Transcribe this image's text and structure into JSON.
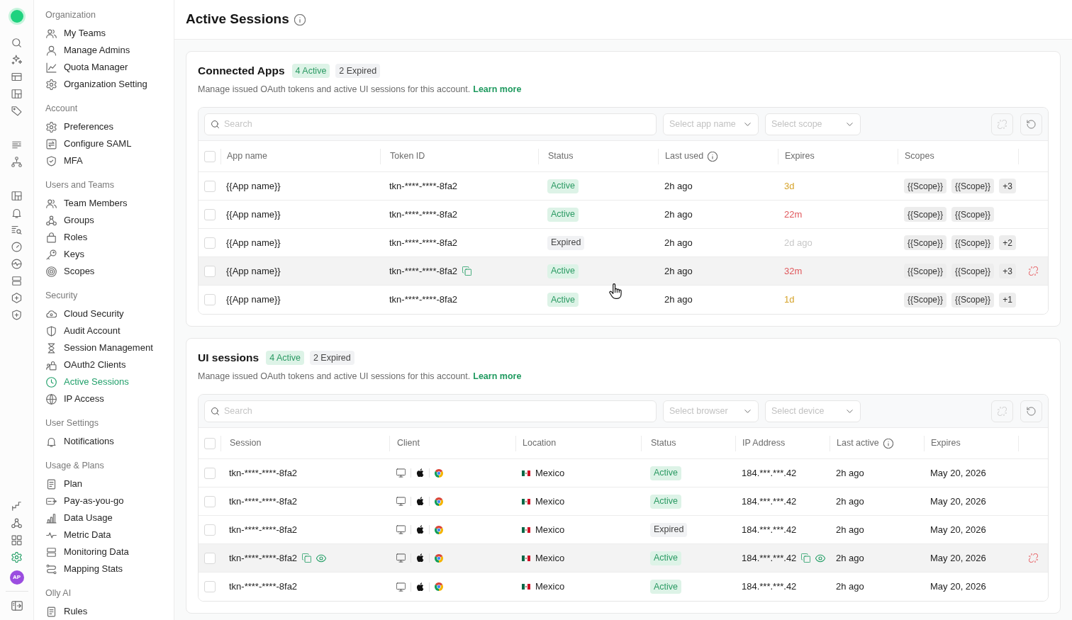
{
  "rail": {
    "items": [
      {
        "selected": false
      },
      {
        "selected": false
      },
      {
        "selected": false
      },
      {
        "selected": false
      },
      {
        "selected": false
      },
      {
        "selected": false
      },
      {
        "selected": false
      },
      {
        "selected": false
      },
      {
        "selected": false
      },
      {
        "selected": false
      },
      {
        "selected": false
      },
      {
        "selected": false
      },
      {
        "selected": false
      },
      {
        "selected": false
      },
      {
        "selected": false
      },
      {
        "selected": false
      },
      {
        "selected": false
      },
      {
        "selected": false
      },
      {
        "selected": true
      }
    ],
    "avatar": "AP"
  },
  "sidebar": {
    "sections": [
      {
        "title": "Organization",
        "items": [
          {
            "label": "My Teams",
            "selected": false
          },
          {
            "label": "Manage Admins",
            "selected": false
          },
          {
            "label": "Quota Manager",
            "selected": false
          },
          {
            "label": "Organization Setting",
            "selected": false
          }
        ]
      },
      {
        "title": "Account",
        "items": [
          {
            "label": "Preferences",
            "selected": false
          },
          {
            "label": "Configure SAML",
            "selected": false
          },
          {
            "label": "MFA",
            "selected": false
          }
        ]
      },
      {
        "title": "Users and Teams",
        "items": [
          {
            "label": "Team Members",
            "selected": false
          },
          {
            "label": "Groups",
            "selected": false
          },
          {
            "label": "Roles",
            "selected": false
          },
          {
            "label": "Keys",
            "selected": false
          },
          {
            "label": "Scopes",
            "selected": false
          }
        ]
      },
      {
        "title": "Security",
        "items": [
          {
            "label": "Cloud Security",
            "selected": false
          },
          {
            "label": "Audit Account",
            "selected": false
          },
          {
            "label": "Session Management",
            "selected": false
          },
          {
            "label": "OAuth2 Clients",
            "selected": false
          },
          {
            "label": "Active Sessions",
            "selected": true
          },
          {
            "label": "IP Access",
            "selected": false
          }
        ]
      },
      {
        "title": "User Settings",
        "items": [
          {
            "label": "Notifications",
            "selected": false
          }
        ]
      },
      {
        "title": "Usage & Plans",
        "items": [
          {
            "label": "Plan",
            "selected": false
          },
          {
            "label": "Pay-as-you-go",
            "selected": false
          },
          {
            "label": "Data Usage",
            "selected": false
          },
          {
            "label": "Metric Data",
            "selected": false
          },
          {
            "label": "Monitoring Data",
            "selected": false
          },
          {
            "label": "Mapping Stats",
            "selected": false
          }
        ]
      },
      {
        "title": "Olly AI",
        "items": [
          {
            "label": "Rules",
            "selected": false
          }
        ]
      }
    ]
  },
  "page": {
    "title": "Active Sessions"
  },
  "connected_apps": {
    "title": "Connected Apps",
    "badges": [
      {
        "text": "4 Active",
        "kind": "active"
      },
      {
        "text": "2 Expired",
        "kind": "expired"
      }
    ],
    "description": "Manage issued OAuth tokens and active UI sessions for this account.",
    "link": "Learn more",
    "toolbar": {
      "search": {
        "placeholder": "Search"
      },
      "filters": [
        {
          "placeholder": "Select app name"
        },
        {
          "placeholder": "Select scope"
        }
      ],
      "revoke": {
        "disabled": true
      }
    },
    "table": {
      "all_checked": false,
      "columns": [
        {
          "label": "App name",
          "info": false
        },
        {
          "label": "Token ID",
          "info": false
        },
        {
          "label": "Status",
          "info": false
        },
        {
          "label": "Last used",
          "info": true
        },
        {
          "label": "Expires",
          "info": false
        },
        {
          "label": "Scopes",
          "info": false
        }
      ],
      "rows": [
        {
          "checked": false,
          "hovered": false,
          "app_name": "{{App name}}",
          "token": "tkn-****-****-8fa2",
          "status": "Active",
          "expired": false,
          "last_used": "2h ago",
          "expires": {
            "text": "3d",
            "color": "#d6a32a"
          },
          "scopes": [
            "{{Scope}}",
            "{{Scope}}"
          ],
          "more": "+3"
        },
        {
          "checked": false,
          "hovered": false,
          "app_name": "{{App name}}",
          "token": "tkn-****-****-8fa2",
          "status": "Active",
          "expired": false,
          "last_used": "2h ago",
          "expires": {
            "text": "22m",
            "color": "#e0575b"
          },
          "scopes": [
            "{{Scope}}",
            "{{Scope}}"
          ]
        },
        {
          "checked": false,
          "hovered": false,
          "app_name": "{{App name}}",
          "token": "tkn-****-****-8fa2",
          "status": "Expired",
          "expired": true,
          "last_used": "2h ago",
          "expires": {
            "text": "2d ago",
            "color": "#c8c8c8"
          },
          "scopes": [
            "{{Scope}}",
            "{{Scope}}"
          ],
          "more": "+2"
        },
        {
          "checked": false,
          "hovered": true,
          "app_name": "{{App name}}",
          "token": "tkn-****-****-8fa2",
          "status": "Active",
          "expired": false,
          "last_used": "2h ago",
          "expires": {
            "text": "32m",
            "color": "#e0575b"
          },
          "scopes": [
            "{{Scope}}",
            "{{Scope}}"
          ],
          "more": "+3"
        },
        {
          "checked": false,
          "hovered": false,
          "app_name": "{{App name}}",
          "token": "tkn-****-****-8fa2",
          "status": "Active",
          "expired": false,
          "last_used": "2h ago",
          "expires": {
            "text": "1d",
            "color": "#d6a32a"
          },
          "scopes": [
            "{{Scope}}",
            "{{Scope}}"
          ],
          "more": "+1"
        }
      ]
    }
  },
  "ui_sessions": {
    "title": "UI sessions",
    "badges": [
      {
        "text": "4 Active",
        "kind": "active"
      },
      {
        "text": "2 Expired",
        "kind": "expired"
      }
    ],
    "description": "Manage issued OAuth tokens and active UI sessions for this account.",
    "link": "Learn more",
    "toolbar": {
      "search": {
        "placeholder": "Search"
      },
      "filters": [
        {
          "placeholder": "Select browser"
        },
        {
          "placeholder": "Select device"
        }
      ],
      "revoke": {
        "disabled": true
      }
    },
    "table": {
      "all_checked": false,
      "columns": [
        {
          "label": "Session",
          "info": false
        },
        {
          "label": "Client",
          "info": false
        },
        {
          "label": "Location",
          "info": false
        },
        {
          "label": "Status",
          "info": false
        },
        {
          "label": "IP Address",
          "info": false
        },
        {
          "label": "Last active",
          "info": true
        },
        {
          "label": "Expires",
          "info": false
        }
      ],
      "rows": [
        {
          "checked": false,
          "hovered": false,
          "session": "tkn-****-****-8fa2",
          "location": "Mexico",
          "status": "Active",
          "expired": false,
          "ip": "184.***.***.42",
          "last_active": "2h ago",
          "expires": "May 20, 2026"
        },
        {
          "checked": false,
          "hovered": false,
          "session": "tkn-****-****-8fa2",
          "location": "Mexico",
          "status": "Active",
          "expired": false,
          "ip": "184.***.***.42",
          "last_active": "2h ago",
          "expires": "May 20, 2026"
        },
        {
          "checked": false,
          "hovered": false,
          "session": "tkn-****-****-8fa2",
          "location": "Mexico",
          "status": "Expired",
          "expired": true,
          "ip": "184.***.***.42",
          "last_active": "2h ago",
          "expires": "May 20, 2026"
        },
        {
          "checked": false,
          "hovered": true,
          "session": "tkn-****-****-8fa2",
          "location": "Mexico",
          "status": "Active",
          "expired": false,
          "ip": "184.***.***.42",
          "last_active": "2h ago",
          "expires": "May 20, 2026"
        },
        {
          "checked": false,
          "hovered": false,
          "session": "tkn-****-****-8fa2",
          "location": "Mexico",
          "status": "Active",
          "expired": false,
          "ip": "184.***.***.42",
          "last_active": "2h ago",
          "expires": "May 20, 2026"
        }
      ]
    }
  }
}
